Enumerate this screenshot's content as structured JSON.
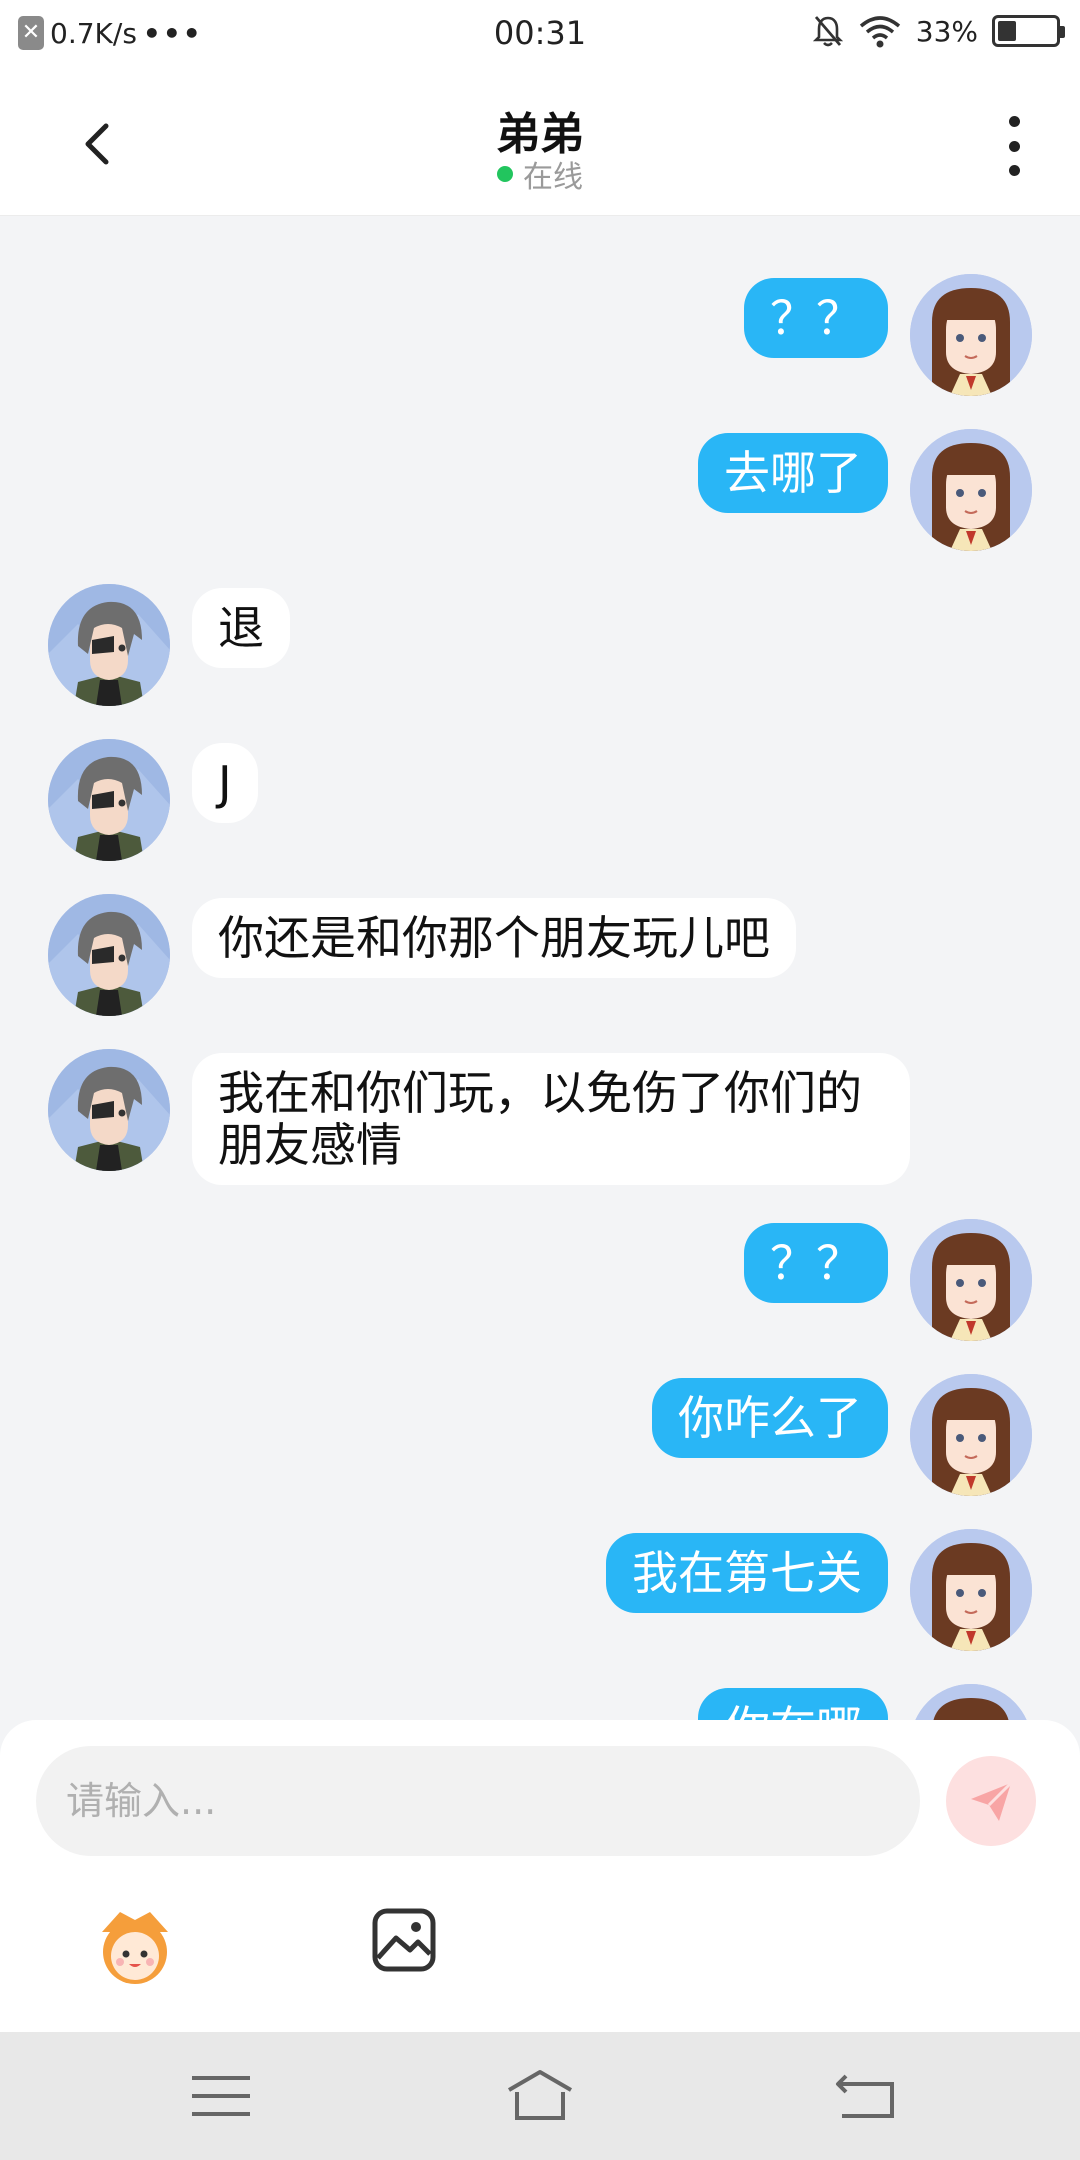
{
  "status_bar": {
    "net_speed": "0.7K/s",
    "dots": "•••",
    "time": "00:31",
    "battery": "33%",
    "battery_level": 0.33,
    "icons": [
      "close-x-icon",
      "bell-off-icon",
      "wifi-icon",
      "battery-icon"
    ]
  },
  "header": {
    "title": "弟弟",
    "status": "在线",
    "icons": [
      "chevron-left-icon",
      "more-vertical-icon"
    ]
  },
  "colors": {
    "my_bubble": "#29b6f6",
    "their_bubble": "#ffffff",
    "background": "#f3f4f6",
    "online": "#22c55e"
  },
  "messages": [
    {
      "from": "me",
      "text": "？？"
    },
    {
      "from": "me",
      "text": "去哪了"
    },
    {
      "from": "them",
      "text": "退"
    },
    {
      "from": "them",
      "text": "J"
    },
    {
      "from": "them",
      "text": "你还是和你那个朋友玩儿吧"
    },
    {
      "from": "them",
      "text": "我在和你们玩，以免伤了你们的朋友感情"
    },
    {
      "from": "me",
      "text": "？？"
    },
    {
      "from": "me",
      "text": "你咋么了"
    },
    {
      "from": "me",
      "text": "我在第七关"
    },
    {
      "from": "me",
      "text": "你在哪"
    }
  ],
  "composer": {
    "placeholder": "请输入...",
    "icons": [
      "send-icon",
      "emoji-mascot-icon",
      "image-icon"
    ]
  },
  "nav_bar": {
    "icons": [
      "menu-icon",
      "home-icon",
      "back-icon"
    ]
  }
}
